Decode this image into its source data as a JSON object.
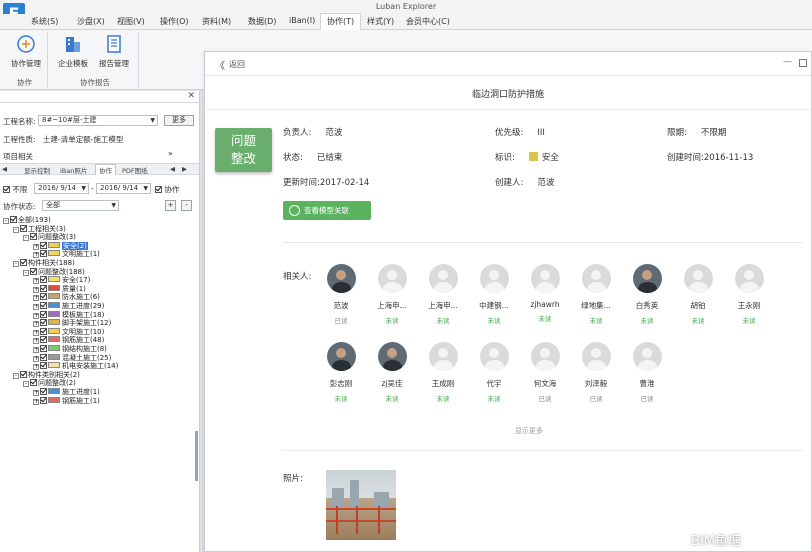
{
  "app": {
    "title": "Luban Explorer",
    "logo_glyph": "E"
  },
  "menu": [
    "系统(S)",
    "沙盘(X)",
    "视图(V)",
    "操作(O)",
    "资料(M)",
    "数据(D)",
    "iBan(I)",
    "协作(T)",
    "样式(Y)",
    "会员中心(C)"
  ],
  "menu_active": "协作(T)",
  "ribbon": {
    "buttons": [
      {
        "label": "协作管理",
        "icon": "collaboration-icon"
      },
      {
        "label": "企业模板",
        "icon": "building-template-icon"
      },
      {
        "label": "报告管理",
        "icon": "report-icon"
      }
    ],
    "groups": [
      "协作",
      "协作报告"
    ]
  },
  "left": {
    "project_label": "工程名称:",
    "project_value": "8#~10#层-土建",
    "more_button": "更多",
    "type_label": "工程性质:",
    "type_value": "土建-清单定额-施工模型",
    "section_label": "项目相关",
    "tabs": [
      "显示控制",
      "iBan照片",
      "协作",
      "PDF图纸"
    ],
    "active_tab": "协作",
    "date_filter_label": "不限",
    "date_from": "2016/ 9/14",
    "date_to": "2016/ 9/14",
    "collab_checkbox_label": "协作",
    "status_label": "协作状态:",
    "status_value": "全部",
    "tree": [
      {
        "text": "全部(193)",
        "level": 0,
        "exp": "-"
      },
      {
        "text": "工程相关(3)",
        "level": 1,
        "exp": "-"
      },
      {
        "text": "问题整改(3)",
        "level": 2,
        "exp": "-"
      },
      {
        "text": "安全(2)",
        "level": 3,
        "exp": "+",
        "swatch": "#e9d24f",
        "selected": true
      },
      {
        "text": "文明施工(1)",
        "level": 3,
        "exp": "+",
        "swatch": "#f0d75b"
      },
      {
        "text": "构件相关(188)",
        "level": 1,
        "exp": "-"
      },
      {
        "text": "问题整改(188)",
        "level": 2,
        "exp": "-"
      },
      {
        "text": "安全(17)",
        "level": 3,
        "exp": "+",
        "swatch": "#f2e46b"
      },
      {
        "text": "质量(1)",
        "level": 3,
        "exp": "+",
        "swatch": "#e24b3c"
      },
      {
        "text": "防水施工(6)",
        "level": 3,
        "exp": "+",
        "swatch": "#c9a26b"
      },
      {
        "text": "施工进度(29)",
        "level": 3,
        "exp": "+",
        "swatch": "#4a8fd8"
      },
      {
        "text": "模板施工(18)",
        "level": 3,
        "exp": "+",
        "swatch": "#a56ac2"
      },
      {
        "text": "脚手架施工(12)",
        "level": 3,
        "exp": "+",
        "swatch": "#e0b250"
      },
      {
        "text": "文明施工(10)",
        "level": 3,
        "exp": "+",
        "swatch": "#f0d04c"
      },
      {
        "text": "钢筋施工(48)",
        "level": 3,
        "exp": "+",
        "swatch": "#e06a66"
      },
      {
        "text": "钢结构施工(8)",
        "level": 3,
        "exp": "+",
        "swatch": "#7fc96c"
      },
      {
        "text": "混凝土施工(25)",
        "level": 3,
        "exp": "+",
        "swatch": "#9a9a9a"
      },
      {
        "text": "机电安装施工(14)",
        "level": 3,
        "exp": "+",
        "swatch": "#f2e2a8"
      },
      {
        "text": "构件类别相关(2)",
        "level": 1,
        "exp": "-"
      },
      {
        "text": "问题整改(2)",
        "level": 2,
        "exp": "-"
      },
      {
        "text": "施工进度(1)",
        "level": 3,
        "exp": "+",
        "swatch": "#4a8fd8"
      },
      {
        "text": "钢筋施工(1)",
        "level": 3,
        "exp": "+",
        "swatch": "#e06a66"
      }
    ]
  },
  "detail": {
    "back_label": "返回",
    "title": "临边洞口防护措施",
    "badge": [
      "问题",
      "整改"
    ],
    "owner_label": "负责人:",
    "owner": "范波",
    "priority_label": "优先级:",
    "priority": "III",
    "deadline_label": "限期:",
    "deadline": "不限期",
    "status_label": "状态:",
    "status": "已结束",
    "tag_label": "标识:",
    "tag": "安全",
    "tag_color": "#d6c64a",
    "created_label": "创建时间:",
    "created": "2016-11-13",
    "updated_label": "更新时间:",
    "updated": "2017-02-14",
    "creator_label": "创建人:",
    "creator": "范波",
    "link_button": "查看模型关联",
    "people_label": "相关人:",
    "people": [
      {
        "name": "范波",
        "status": "已读",
        "photo": true
      },
      {
        "name": "上海申...",
        "status": "未读"
      },
      {
        "name": "上海申...",
        "status": "未读"
      },
      {
        "name": "中建钢...",
        "status": "未读"
      },
      {
        "name": "zjhawrh",
        "status": "未读"
      },
      {
        "name": "绿地集...",
        "status": "未读"
      },
      {
        "name": "白秀英",
        "status": "未读",
        "photo": true
      },
      {
        "name": "胡铂",
        "status": "未读"
      },
      {
        "name": "王永刚",
        "status": "未读"
      },
      {
        "name": "彭志刚",
        "status": "未读",
        "photo": true
      },
      {
        "name": "zj吴佳",
        "status": "未读",
        "photo": true
      },
      {
        "name": "王成刚",
        "status": "未读"
      },
      {
        "name": "代宇",
        "status": "未读"
      },
      {
        "name": "何文海",
        "status": "已读"
      },
      {
        "name": "刘泽毅",
        "status": "已读"
      },
      {
        "name": "曹淮",
        "status": "已读"
      }
    ],
    "show_more": "显示更多",
    "photo_label": "照片:"
  },
  "colors": {
    "read": "#888888",
    "unread": "#3fae4a",
    "accent_green": "#5bb35f",
    "badge_green": "#6aae6d"
  },
  "watermark": "BIM鱼塘"
}
